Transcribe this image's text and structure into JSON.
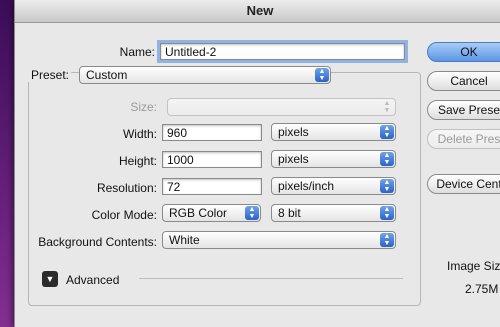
{
  "dialog": {
    "title": "New"
  },
  "form": {
    "name_label": "Name:",
    "name_value": "Untitled-2",
    "preset_label": "Preset:",
    "preset_value": "Custom",
    "size_label": "Size:",
    "size_value": "",
    "width_label": "Width:",
    "width_value": "960",
    "width_unit": "pixels",
    "height_label": "Height:",
    "height_value": "1000",
    "height_unit": "pixels",
    "resolution_label": "Resolution:",
    "resolution_value": "72",
    "resolution_unit": "pixels/inch",
    "color_mode_label": "Color Mode:",
    "color_mode_value": "RGB Color",
    "bit_depth_value": "8 bit",
    "background_label": "Background Contents:",
    "background_value": "White",
    "advanced_label": "Advanced"
  },
  "buttons": {
    "ok": "OK",
    "cancel": "Cancel",
    "save_preset": "Save Prese",
    "delete_preset": "Delete Pres",
    "device_central": "Device Cent"
  },
  "image_size": {
    "label": "Image Siz",
    "value": "2.75M"
  },
  "icons": {
    "popup_arrows": "updown-arrows-icon",
    "disclosure": "disclosure-triangle-icon"
  }
}
